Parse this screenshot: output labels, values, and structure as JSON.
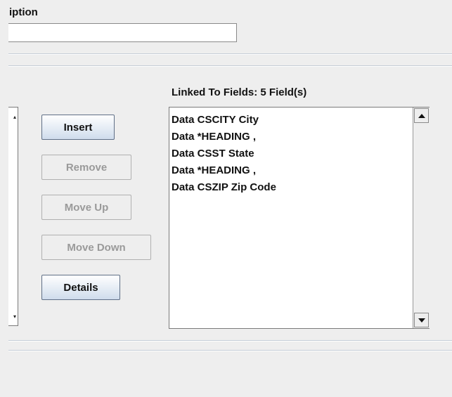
{
  "description": {
    "label": "iption",
    "value": ""
  },
  "buttons": {
    "insert": "Insert",
    "remove": "Remove",
    "move_up": "Move Up",
    "move_down": "Move Down",
    "details": "Details"
  },
  "linked": {
    "label": "Linked To Fields: 5 Field(s)",
    "items": [
      "Data CSCITY City",
      "Data *HEADING ,",
      "Data CSST State",
      "Data *HEADING ,",
      "Data CSZIP Zip Code"
    ]
  },
  "icons": {
    "scroll_up": "scroll-up-icon",
    "scroll_down": "scroll-down-icon"
  }
}
